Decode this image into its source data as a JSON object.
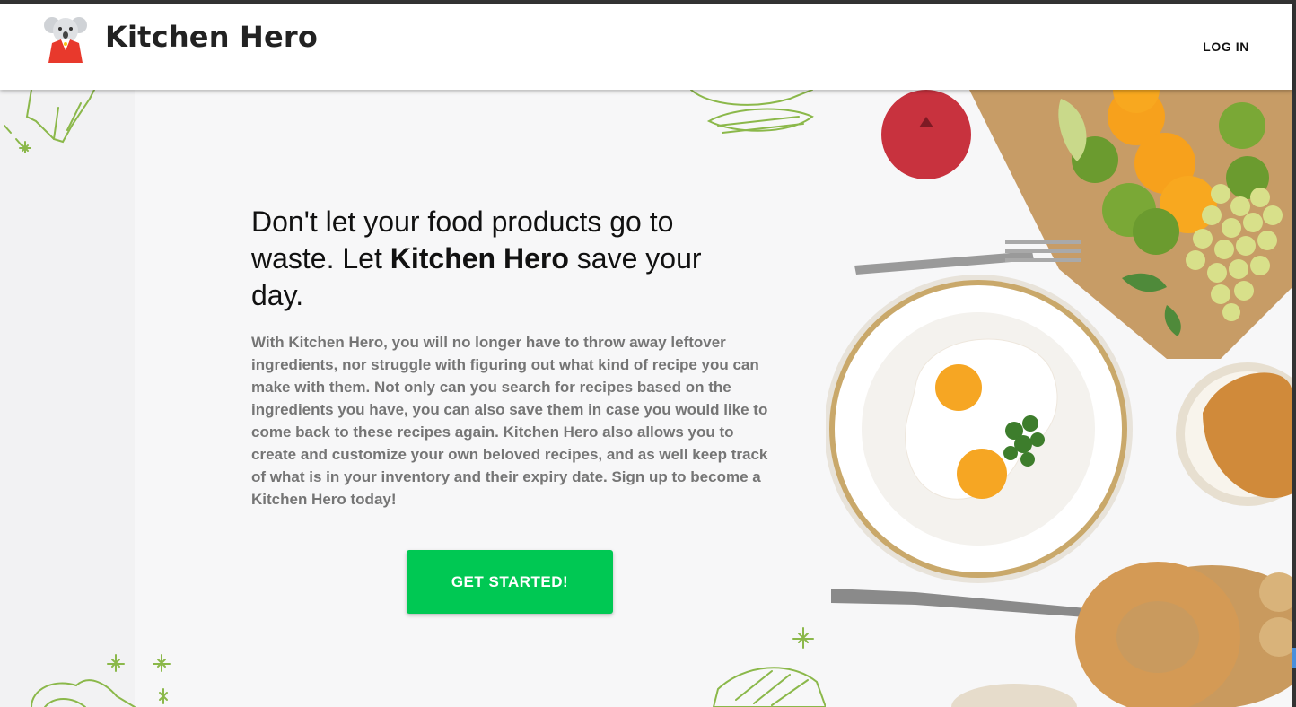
{
  "header": {
    "brand": "Kitchen Hero",
    "login_label": "LOG IN"
  },
  "hero": {
    "headline_part1": "Don't let your food products go to waste. Let ",
    "headline_bold": "Kitchen Hero",
    "headline_part2": " save your day.",
    "description": "With Kitchen Hero, you will no longer have to throw away leftover ingredients, nor struggle with figuring out what kind of recipe you can make with them. Not only can you search for recipes based on the ingredients you have, you can also save them in case you would like to come back to these recipes again. Kitchen Hero also allows you to create and customize your own beloved recipes, and as well keep track of what is in your inventory and their expiry date. Sign up to become a Kitchen Hero today!",
    "cta_label": "GET STARTED!"
  },
  "colors": {
    "accent": "#00c853",
    "text": "#111111",
    "muted_text": "#757575",
    "doodle": "#8bb84a"
  },
  "icons": {
    "logo": "koala-chef-logo-icon"
  }
}
